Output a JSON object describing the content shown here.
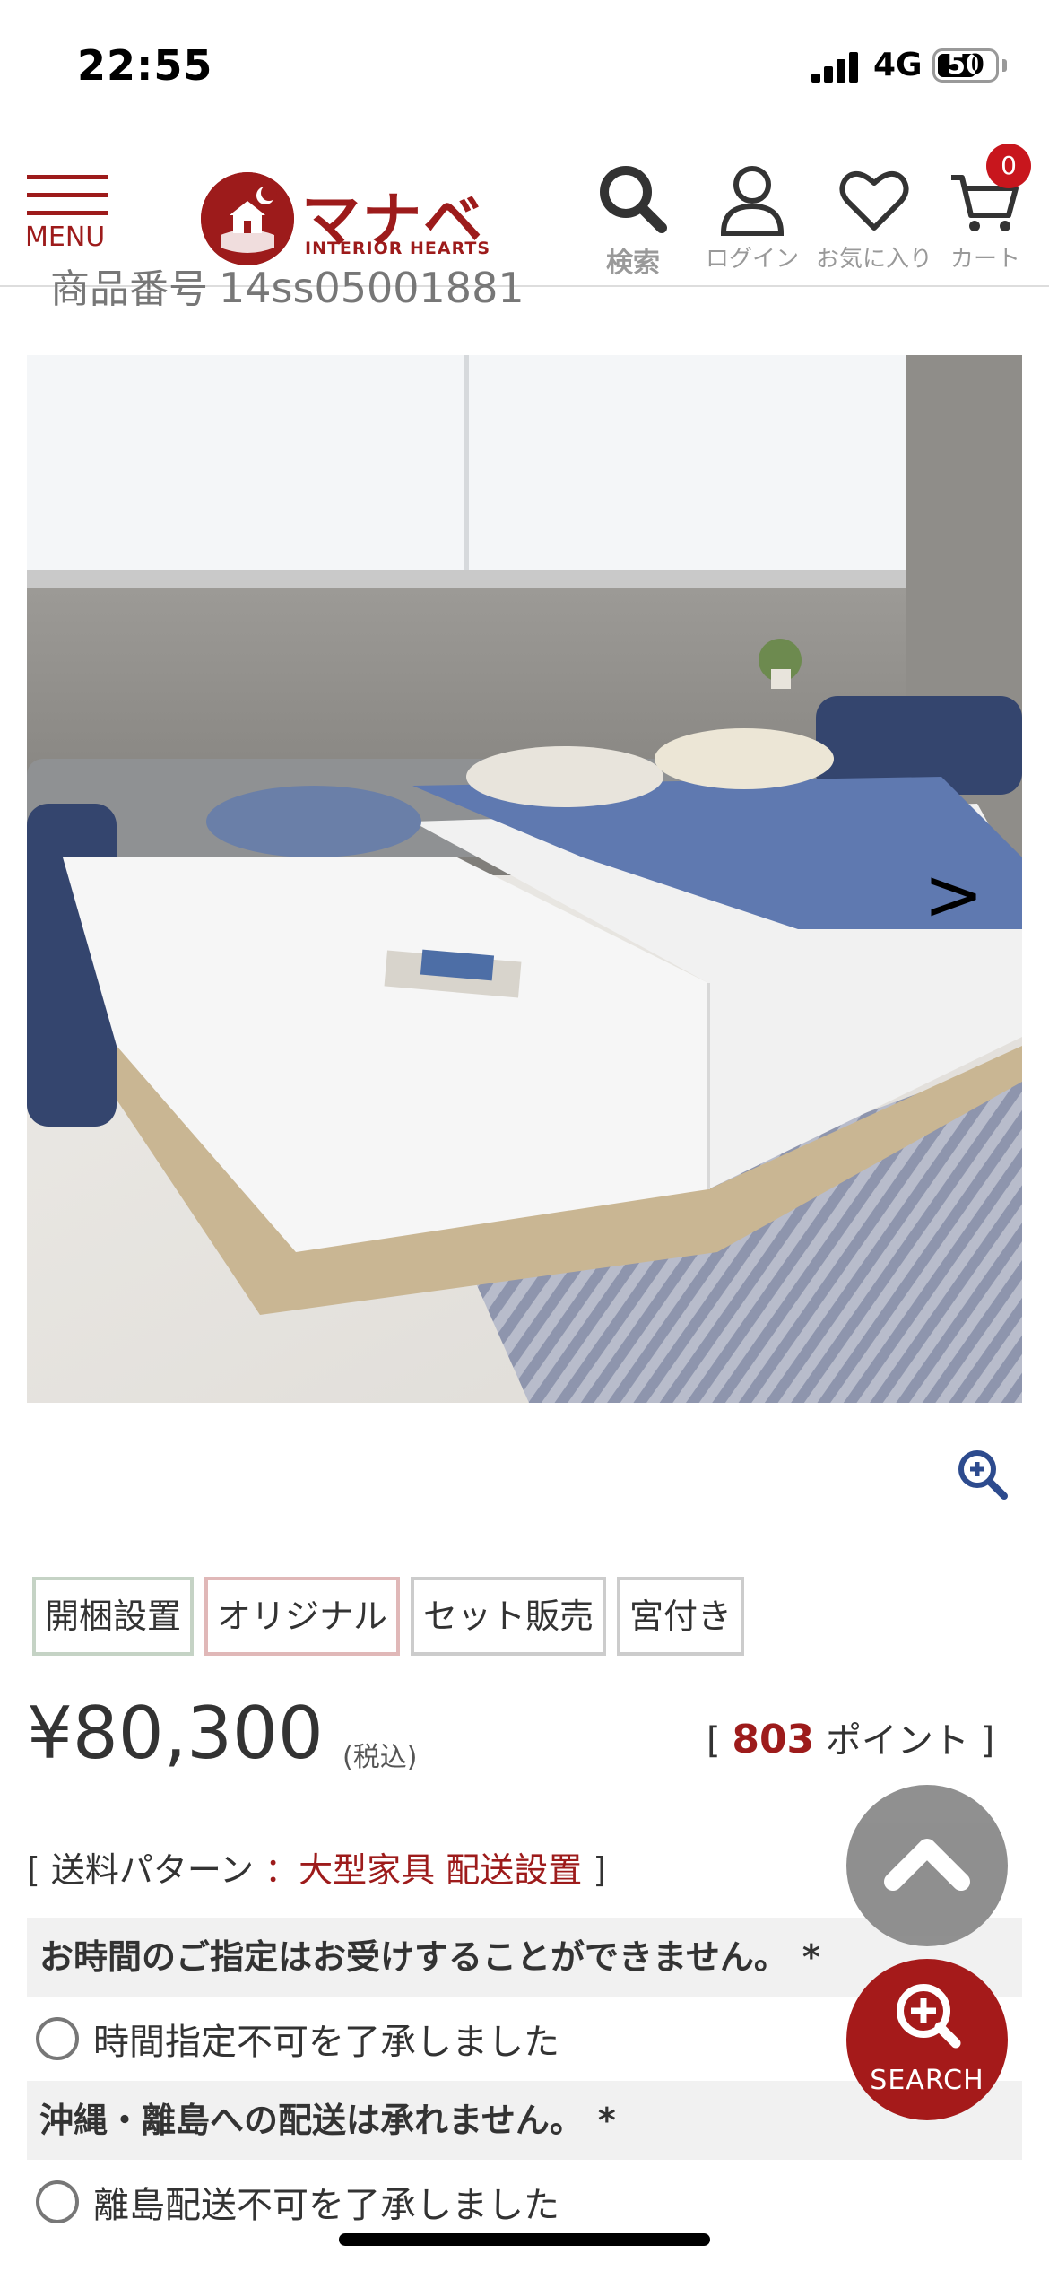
{
  "status_bar": {
    "time": "22:55",
    "network": "4G",
    "battery": "50"
  },
  "header": {
    "menu_label": "MENU",
    "logo_text": "マナベ",
    "logo_sub": "INTERIOR HEARTS",
    "search_label": "検索",
    "login_label": "ログイン",
    "favorites_label": "お気に入り",
    "cart_label": "カート",
    "cart_count": "0"
  },
  "product": {
    "number_label": "商品番号",
    "number_value": "14ss05001881",
    "next_arrow": ">",
    "tags": [
      "開梱設置",
      "オリジナル",
      "セット販売",
      "宮付き"
    ],
    "price": "¥80,300",
    "tax_note": "(税込)",
    "points_open": "[",
    "points_value": "803",
    "points_label": "ポイント",
    "points_close": "]"
  },
  "shipping": {
    "open": "[",
    "label": "送料パターン",
    "sep": "：",
    "value": "大型家具 配送設置",
    "close": "]"
  },
  "notices": [
    {
      "title": "お時間のご指定はお受けすることができません。",
      "required": "*",
      "checkbox_label": "時間指定不可を了承しました"
    },
    {
      "title": "沖縄・離島への配送は承れません。",
      "required": "*",
      "checkbox_label": "離島配送不可を了承しました"
    }
  ],
  "fab": {
    "search_label": "SEARCH"
  },
  "colors": {
    "brand": "#9d1b1b",
    "badge": "#c8161d",
    "fab_gray": "#8a8a8a"
  }
}
